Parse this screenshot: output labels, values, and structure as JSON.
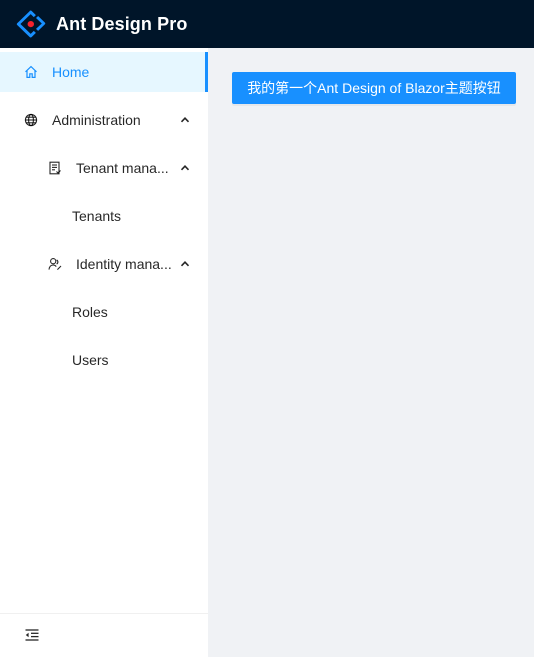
{
  "header": {
    "title": "Ant Design Pro",
    "logo_icon": "ant-design-logo-icon",
    "background_color": "#001529"
  },
  "sidebar": {
    "items": [
      {
        "label": "Home",
        "icon": "home-icon",
        "selected": true
      },
      {
        "label": "Administration",
        "icon": "global-icon",
        "expanded": true
      },
      {
        "label": "Tenant management",
        "display": "Tenant mana...",
        "icon": "audit-icon",
        "expanded": true
      },
      {
        "label": "Tenants"
      },
      {
        "label": "Identity management",
        "display": "Identity mana...",
        "icon": "team-icon",
        "expanded": true
      },
      {
        "label": "Roles"
      },
      {
        "label": "Users"
      }
    ],
    "collapse_icon": "menu-fold-icon"
  },
  "main": {
    "button_label": "我的第一个Ant Design of Blazor主题按钮"
  },
  "colors": {
    "primary": "#1890ff",
    "selected_bg": "#e6f7ff",
    "content_bg": "#f0f2f5"
  }
}
